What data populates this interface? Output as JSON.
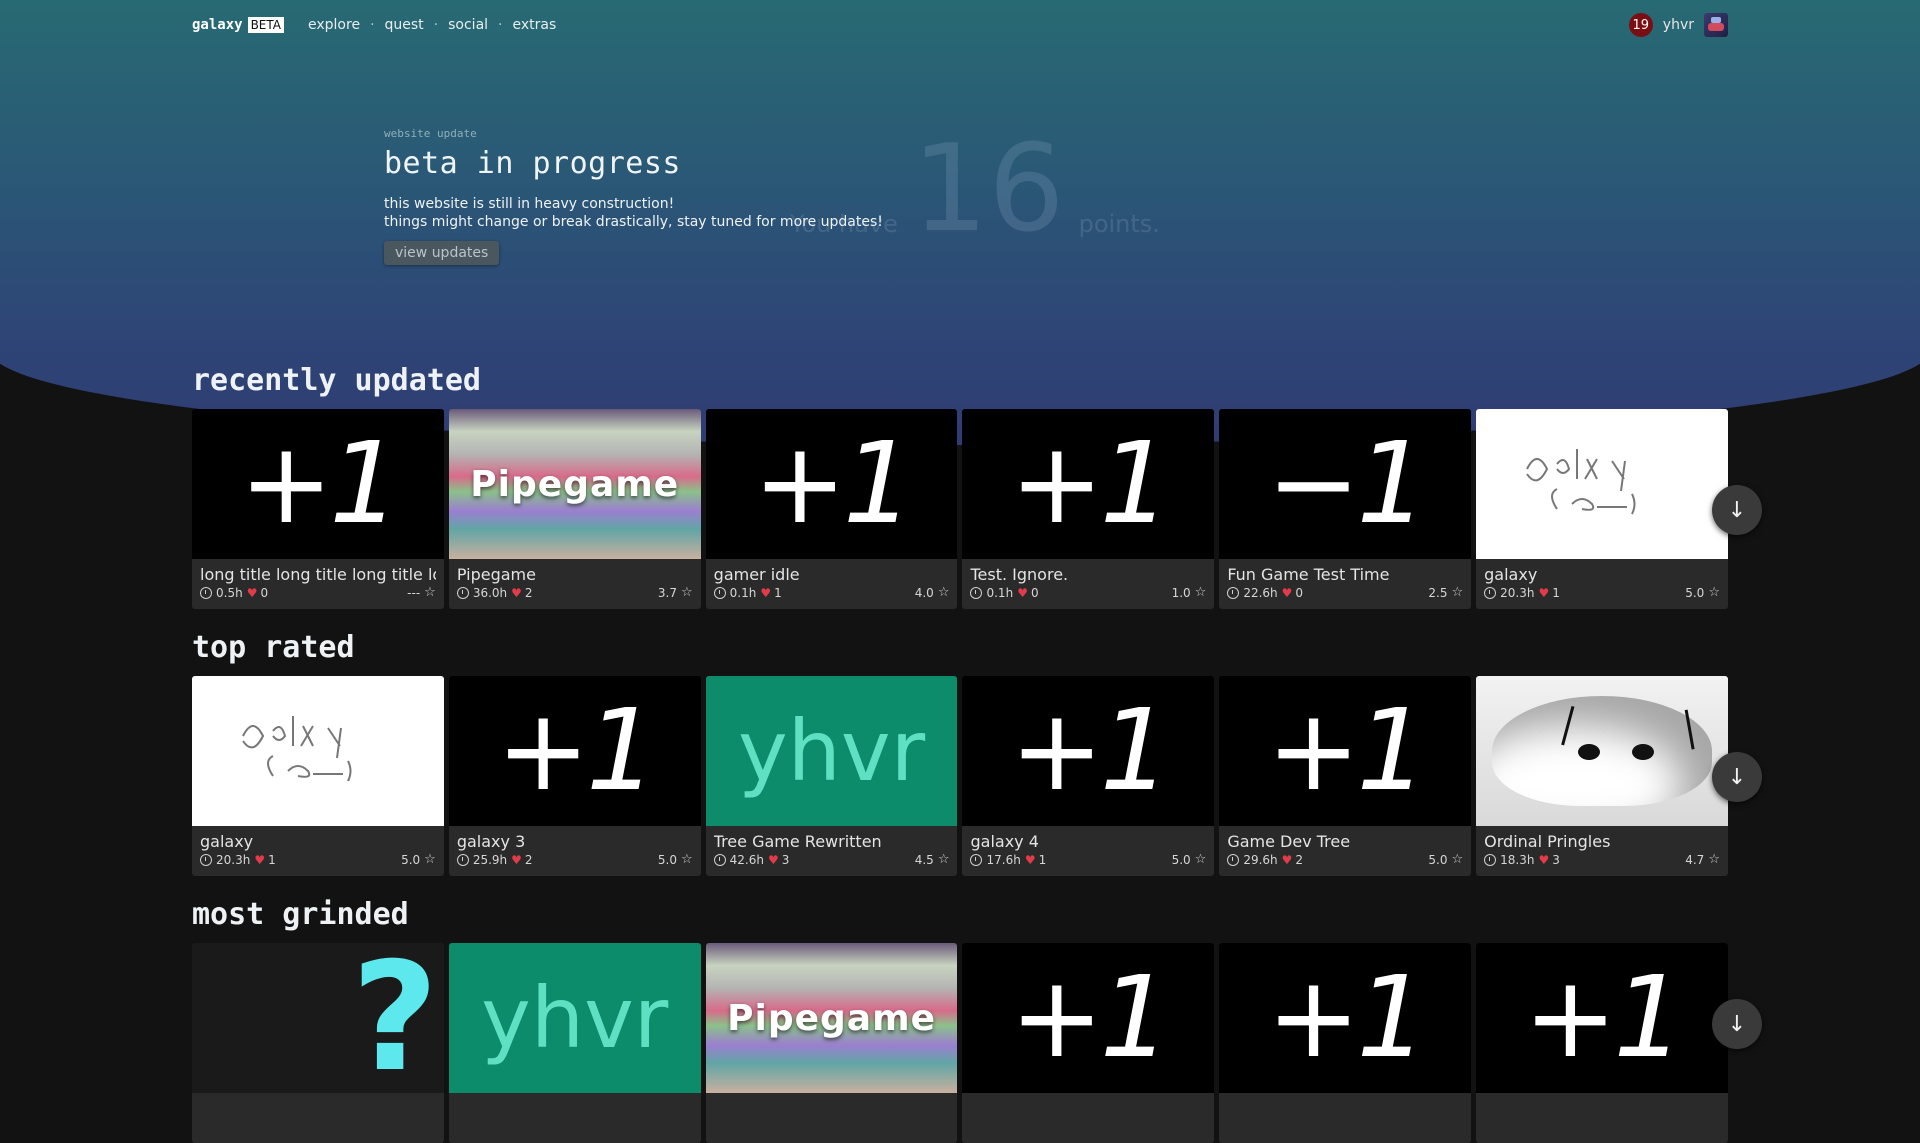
{
  "nav": {
    "brand": "galaxy",
    "badge": "BETA",
    "links": [
      "explore",
      "quest",
      "social",
      "extras"
    ],
    "separator": "·",
    "notifications": "19",
    "username": "yhvr"
  },
  "points": {
    "prefix": "You have",
    "value": "16",
    "suffix": "points."
  },
  "update": {
    "eyebrow": "website update",
    "title": "beta in progress",
    "line1": "this website is still in heavy construction!",
    "line2": "things might change or break drastically, stay tuned for more updates!",
    "button": "view updates"
  },
  "sections": [
    {
      "title": "recently updated",
      "cards": [
        {
          "title": "long title long title long title long title",
          "hours": "0.5h",
          "likes": "0",
          "rating": "---",
          "thumb": "+1"
        },
        {
          "title": "Pipegame",
          "hours": "36.0h",
          "likes": "2",
          "rating": "3.7",
          "thumb": "Pipegame"
        },
        {
          "title": "gamer idle",
          "hours": "0.1h",
          "likes": "1",
          "rating": "4.0",
          "thumb": "+1"
        },
        {
          "title": "Test. Ignore.",
          "hours": "0.1h",
          "likes": "0",
          "rating": "1.0",
          "thumb": "+1"
        },
        {
          "title": "Fun Game Test Time",
          "hours": "22.6h",
          "likes": "0",
          "rating": "2.5",
          "thumb": "−1"
        },
        {
          "title": "galaxy",
          "hours": "20.3h",
          "likes": "1",
          "rating": "5.0",
          "thumb": "scribble"
        }
      ]
    },
    {
      "title": "top rated",
      "cards": [
        {
          "title": "galaxy",
          "hours": "20.3h",
          "likes": "1",
          "rating": "5.0",
          "thumb": "scribble"
        },
        {
          "title": "galaxy 3",
          "hours": "25.9h",
          "likes": "2",
          "rating": "5.0",
          "thumb": "+1"
        },
        {
          "title": "Tree Game Rewritten",
          "hours": "42.6h",
          "likes": "3",
          "rating": "4.5",
          "thumb": "yhvr"
        },
        {
          "title": "galaxy 4",
          "hours": "17.6h",
          "likes": "1",
          "rating": "5.0",
          "thumb": "+1"
        },
        {
          "title": "Game Dev Tree",
          "hours": "29.6h",
          "likes": "2",
          "rating": "5.0",
          "thumb": "+1"
        },
        {
          "title": "Ordinal Pringles",
          "hours": "18.3h",
          "likes": "3",
          "rating": "4.7",
          "thumb": "cat"
        }
      ]
    },
    {
      "title": "most grinded",
      "cards": [
        {
          "thumb": "?"
        },
        {
          "thumb": "yhvr"
        },
        {
          "thumb": "Pipegame"
        },
        {
          "thumb": "+1"
        },
        {
          "thumb": "+1"
        },
        {
          "thumb": "+1"
        }
      ]
    }
  ],
  "icons": {
    "scroll": "arrow-down-icon",
    "time": "clock-icon",
    "likes": "heart-icon",
    "rating": "star-icon"
  },
  "colors": {
    "hero_top": "#286a73",
    "hero_bottom": "#2f3c72",
    "background": "#121212",
    "card": "#2a2a2a",
    "heart": "#e23b4a",
    "notification": "#7a0e12",
    "green_thumb": "#0d8c6c"
  }
}
